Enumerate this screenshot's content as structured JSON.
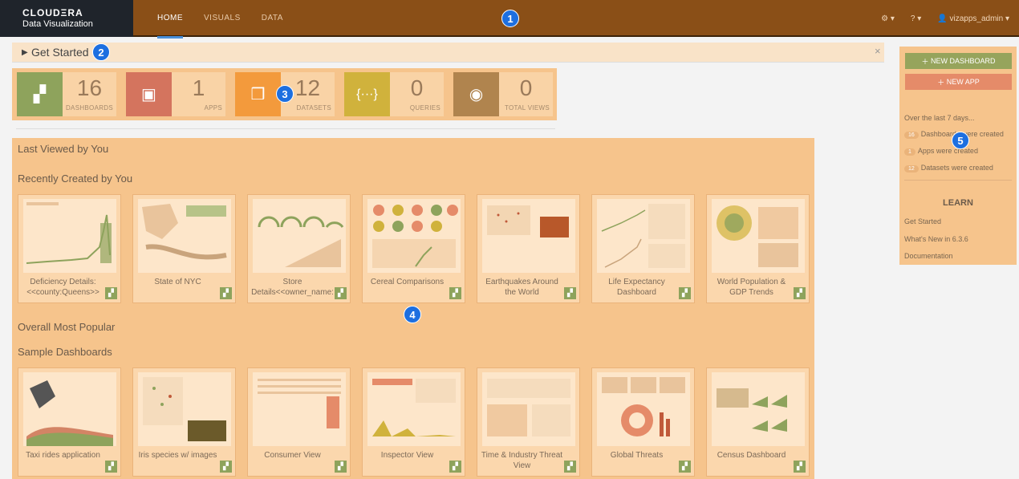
{
  "app": {
    "brand_line1": "CLOUDΞRA",
    "brand_line2": "Data Visualization"
  },
  "nav": {
    "tabs": [
      "HOME",
      "VISUALS",
      "DATA"
    ],
    "active": "HOME",
    "user": "vizapps_admin ▾",
    "settings_caret": "▾",
    "help_caret": "▾"
  },
  "markers": [
    "1",
    "2",
    "3",
    "4",
    "5"
  ],
  "get_started": {
    "label": "Get Started",
    "close": "×"
  },
  "stats": [
    {
      "value": "16",
      "label": "DASHBOARDS",
      "color": "#8ea35c",
      "icon": "dashboard-icon"
    },
    {
      "value": "1",
      "label": "APPS",
      "color": "#d4745e",
      "icon": "app-icon"
    },
    {
      "value": "12",
      "label": "DATASETS",
      "color": "#f39a3c",
      "icon": "cubes-icon"
    },
    {
      "value": "0",
      "label": "QUERIES",
      "color": "#d0b23c",
      "icon": "braces-icon"
    },
    {
      "value": "0",
      "label": "TOTAL VIEWS",
      "color": "#b0844e",
      "icon": "eye-icon"
    }
  ],
  "sections": {
    "last_viewed": "Last Viewed by You",
    "recently_created": "Recently Created by You",
    "most_popular": "Overall Most Popular",
    "sample": "Sample Dashboards"
  },
  "recent_cards": [
    "Deficiency Details: <<county:Queens>>",
    "State of NYC",
    "Store Details<<owner_name:",
    "Cereal Comparisons",
    "Earthquakes Around the World",
    "Life Expectancy Dashboard",
    "World Population & GDP Trends"
  ],
  "sample_cards": [
    "Taxi rides application",
    "Iris species w/ images",
    "Consumer View",
    "Inspector View",
    "Time & Industry Threat View",
    "Global Threats",
    "Census Dashboard"
  ],
  "right_panel": {
    "new_dashboard": "NEW DASHBOARD",
    "new_app": "NEW APP",
    "period": "Over the last 7 days...",
    "activity": [
      {
        "count": "16",
        "text": "Dashboards were created"
      },
      {
        "count": "1",
        "text": "Apps were created"
      },
      {
        "count": "12",
        "text": "Datasets were created"
      }
    ],
    "learn_title": "LEARN",
    "links": [
      "Get Started",
      "What's New in 6.3.6",
      "Documentation"
    ]
  }
}
